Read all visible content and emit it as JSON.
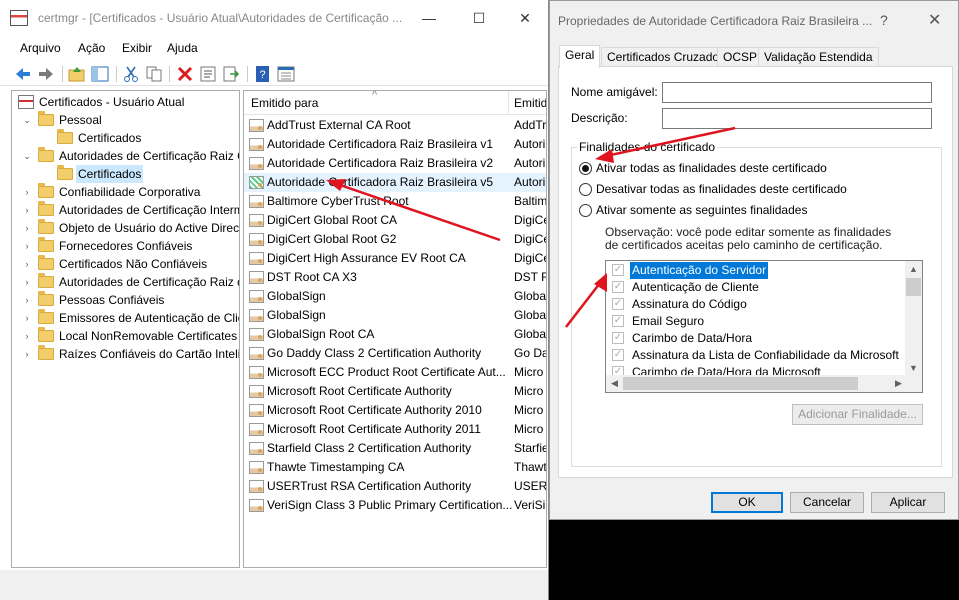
{
  "main_window": {
    "title": "certmgr - [Certificados - Usuário Atual\\Autoridades de Certificação ...",
    "minimize": "—",
    "maximize": "☐",
    "close": "✕",
    "menu": [
      "Arquivo",
      "Ação",
      "Exibir",
      "Ajuda"
    ],
    "toolbar_icons": [
      "back-arrow-icon",
      "forward-arrow-icon",
      "up-folder-icon",
      "show-hide-tree-icon",
      "cut-icon",
      "copy-icon",
      "delete-icon",
      "properties-icon",
      "export-icon",
      "help-icon",
      "details-view-icon"
    ]
  },
  "tree": [
    {
      "label": "Certificados - Usuário Atual",
      "level": 0,
      "expander": "",
      "icon": "root"
    },
    {
      "label": "Pessoal",
      "level": 1,
      "expander": "⌄"
    },
    {
      "label": "Certificados",
      "level": 2,
      "expander": ""
    },
    {
      "label": "Autoridades de Certificação Raiz C",
      "level": 1,
      "expander": "⌄"
    },
    {
      "label": "Certificados",
      "level": 2,
      "expander": "",
      "selected": true
    },
    {
      "label": "Confiabilidade Corporativa",
      "level": 1,
      "expander": "›"
    },
    {
      "label": "Autoridades de Certificação Interm",
      "level": 1,
      "expander": "›"
    },
    {
      "label": "Objeto de Usuário do Active Direct",
      "level": 1,
      "expander": "›"
    },
    {
      "label": "Fornecedores Confiáveis",
      "level": 1,
      "expander": "›"
    },
    {
      "label": "Certificados Não Confiáveis",
      "level": 1,
      "expander": "›"
    },
    {
      "label": "Autoridades de Certificação Raiz de",
      "level": 1,
      "expander": "›"
    },
    {
      "label": "Pessoas Confiáveis",
      "level": 1,
      "expander": "›"
    },
    {
      "label": "Emissores de Autenticação de Clien",
      "level": 1,
      "expander": "›"
    },
    {
      "label": "Local NonRemovable Certificates",
      "level": 1,
      "expander": "›"
    },
    {
      "label": "Raízes Confiáveis do Cartão Intelig",
      "level": 1,
      "expander": "›"
    }
  ],
  "cert_list": {
    "columns": [
      "Emitido para",
      "Emitido"
    ],
    "sort_indicator": "^",
    "rows": [
      {
        "name": "AddTrust External CA Root",
        "issued_by": "AddTru"
      },
      {
        "name": "Autoridade Certificadora Raiz Brasileira v1",
        "issued_by": "Autori"
      },
      {
        "name": "Autoridade Certificadora Raiz Brasileira v2",
        "issued_by": "Autori"
      },
      {
        "name": "Autoridade Certificadora Raiz Brasileira v5",
        "issued_by": "Autori",
        "highlight": true
      },
      {
        "name": "Baltimore CyberTrust Root",
        "issued_by": "Baltim"
      },
      {
        "name": "DigiCert Global Root CA",
        "issued_by": "DigiCe"
      },
      {
        "name": "DigiCert Global Root G2",
        "issued_by": "DigiCe"
      },
      {
        "name": "DigiCert High Assurance EV Root CA",
        "issued_by": "DigiCe"
      },
      {
        "name": "DST Root CA X3",
        "issued_by": "DST Ro"
      },
      {
        "name": "GlobalSign",
        "issued_by": "Globa"
      },
      {
        "name": "GlobalSign",
        "issued_by": "Globa"
      },
      {
        "name": "GlobalSign Root CA",
        "issued_by": "Globa"
      },
      {
        "name": "Go Daddy Class 2 Certification Authority",
        "issued_by": "Go Da"
      },
      {
        "name": "Microsoft ECC Product Root Certificate Aut...",
        "issued_by": "Micro"
      },
      {
        "name": "Microsoft Root Certificate Authority",
        "issued_by": "Micro"
      },
      {
        "name": "Microsoft Root Certificate Authority 2010",
        "issued_by": "Micro"
      },
      {
        "name": "Microsoft Root Certificate Authority 2011",
        "issued_by": "Micro"
      },
      {
        "name": "Starfield Class 2 Certification Authority",
        "issued_by": "Starfie"
      },
      {
        "name": "Thawte Timestamping CA",
        "issued_by": "Thawt"
      },
      {
        "name": "USERTrust RSA Certification Authority",
        "issued_by": "USERT"
      },
      {
        "name": "VeriSign Class 3 Public Primary Certification...",
        "issued_by": "VeriSi"
      }
    ]
  },
  "dialog": {
    "title": "Propriedades de Autoridade Certificadora Raiz Brasileira ...",
    "help": "?",
    "close": "✕",
    "tabs": [
      "Geral",
      "Certificados Cruzados",
      "OCSP",
      "Validação Estendida"
    ],
    "friendly_name_label": "Nome amigável:",
    "friendly_name_value": "",
    "description_label": "Descrição:",
    "description_value": "",
    "group_title": "Finalidades do certificado",
    "radios": [
      {
        "label": "Ativar todas as finalidades deste certificado",
        "checked": true
      },
      {
        "label": "Desativar todas as finalidades deste certificado",
        "checked": false
      },
      {
        "label": "Ativar somente as seguintes finalidades",
        "checked": false
      }
    ],
    "note": "Observação: você pode editar somente as finalidades de certificados aceitas pelo caminho de certificação.",
    "purposes": [
      {
        "label": "Autenticação do Servidor",
        "checked": true,
        "selected": true
      },
      {
        "label": "Autenticação de Cliente",
        "checked": true
      },
      {
        "label": "Assinatura do Código",
        "checked": true
      },
      {
        "label": "Email Seguro",
        "checked": true
      },
      {
        "label": "Carimbo de Data/Hora",
        "checked": true
      },
      {
        "label": "Assinatura da Lista de Confiabilidade da Microsoft",
        "checked": true
      },
      {
        "label": "Carimbo de Data/Hora da Microsoft",
        "checked": true
      }
    ],
    "check_glyph": "✓",
    "scroll_up": "▲",
    "scroll_down": "▼",
    "scroll_left": "◀",
    "scroll_right": "▶",
    "add_purpose_button": "Adicionar Finalidade...",
    "ok_button": "OK",
    "cancel_button": "Cancelar",
    "apply_button": "Aplicar"
  },
  "colors": {
    "annotation_arrow": "#e0141e",
    "selection_blue": "#0078d7",
    "tree_selection": "#cce8ff"
  }
}
